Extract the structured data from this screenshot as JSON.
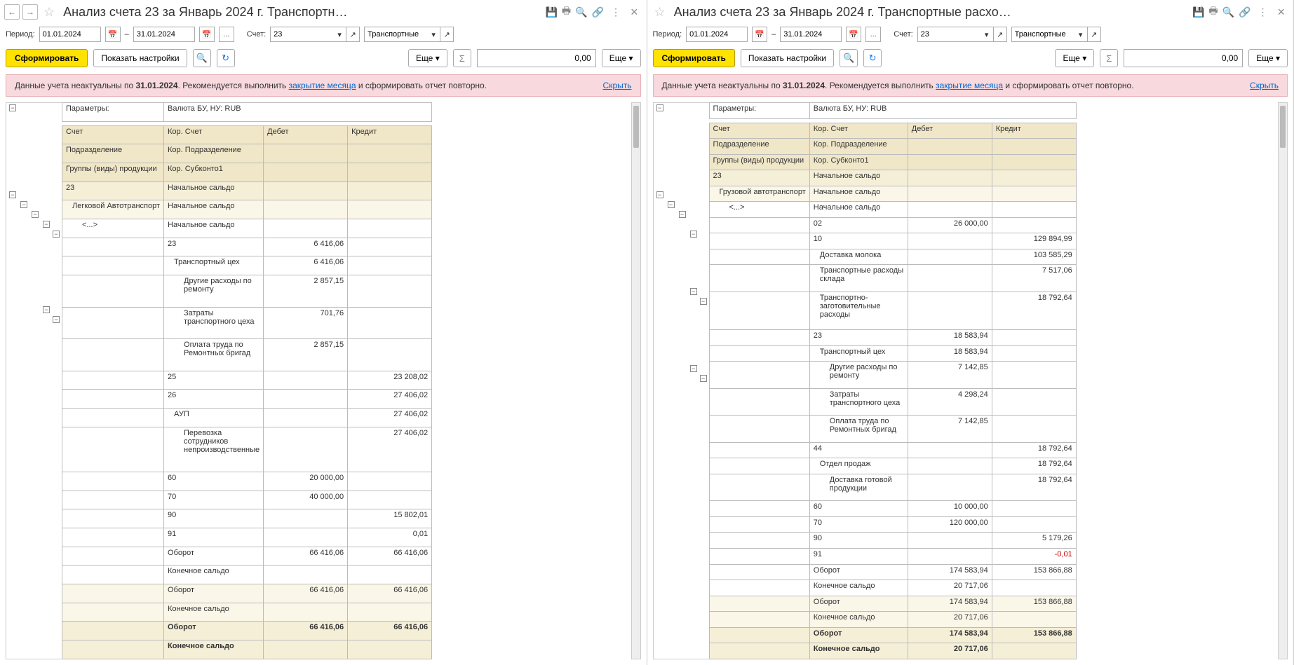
{
  "titleLeft": "Анализ счета 23 за Январь 2024 г. Транспортн…",
  "titleRight": "Анализ счета 23 за Январь 2024 г. Транспортные расхо…",
  "periodLabel": "Период:",
  "dateFrom": "01.01.2024",
  "dateTo": "31.01.2024",
  "dash": "–",
  "dotsBtn": "...",
  "acctLabel": "Счет:",
  "acctValue": "23",
  "orgValue": "Транспортные",
  "btnGenerate": "Сформировать",
  "btnSettings": "Показать настройки",
  "btnMore": "Еще",
  "numZero": "0,00",
  "alertPrefix": "Данные учета неактуальны по ",
  "alertDate": "31.01.2024",
  "alertMiddle": ". Рекомендуется выполнить ",
  "alertLink": "закрытие месяца",
  "alertSuffix": " и сформировать отчет повторно.",
  "hideLink": "Скрыть",
  "paramsLabel": "Параметры:",
  "paramsValue": "Валюта БУ, НУ: RUB",
  "hdr": {
    "acct": "Счет",
    "kor": "Кор. Счет",
    "deb": "Дебет",
    "cred": "Кредит",
    "dept": "Подразделение",
    "kordept": "Кор. Подразделение",
    "groups": "Группы (виды) продукции",
    "korsub": "Кор. Субконто1"
  },
  "txt": {
    "startBal": "Начальное сальдо",
    "endBal": "Конечное сальдо",
    "turnover": "Оборот",
    "ellipsis": "<...>",
    "a23": "23",
    "legkovoy": "Легковой Автотранспорт",
    "transCeh": "Транспортный цех",
    "drugRemont": "Другие расходы по ремонту",
    "zatrCeh": "Затраты транспортного цеха",
    "oplataRem": "Оплата труда по Ремонтных бригад",
    "a25": "25",
    "a26": "26",
    "aup": "АУП",
    "perevozka": "Перевозка сотрудников непроизводственные",
    "a60": "60",
    "a70": "70",
    "a90": "90",
    "a91": "91",
    "gruzovoy": "Грузовой автотранспорт",
    "a02": "02",
    "a10": "10",
    "dostavkaMoloka": "Доставка молока",
    "transRashSklada": "Транспортные расходы  склада",
    "transZagot": "Транспортно-заготовительные расходы",
    "a44": "44",
    "otdelProdazh": "Отдел продаж",
    "dostavkaGotov": "Доставка готовой продукции"
  },
  "v": {
    "l_23deb": "6 416,06",
    "l_transCehDeb": "6 416,06",
    "l_drugRemDeb": "2 857,15",
    "l_zatrCehDeb": "701,76",
    "l_oplataRemDeb": "2 857,15",
    "l_25cred": "23 208,02",
    "l_26cred": "27 406,02",
    "l_aupCred": "27 406,02",
    "l_perevozkaCred": "27 406,02",
    "l_60deb": "20 000,00",
    "l_70deb": "40 000,00",
    "l_90cred": "15 802,01",
    "l_91cred": "0,01",
    "l_turnDeb1": "66 416,06",
    "l_turnCred1": "66 416,06",
    "l_turnDeb2": "66 416,06",
    "l_turnCred2": "66 416,06",
    "l_turnDeb3": "66 416,06",
    "l_turnCred3": "66 416,06",
    "r_02deb": "26 000,00",
    "r_10cred": "129 894,99",
    "r_dostMolokaCred": "103 585,29",
    "r_transSkladaCred": "7 517,06",
    "r_transZagotCred": "18 792,64",
    "r_23deb": "18 583,94",
    "r_transCehDeb": "18 583,94",
    "r_drugRemDeb": "7 142,85",
    "r_zatrCehDeb": "4 298,24",
    "r_oplataRemDeb": "7 142,85",
    "r_44cred": "18 792,64",
    "r_otdelCred": "18 792,64",
    "r_dostGotovCred": "18 792,64",
    "r_60deb": "10 000,00",
    "r_70deb": "120 000,00",
    "r_90cred": "5 179,26",
    "r_91cred": "-0,01",
    "r_turn1deb": "174 583,94",
    "r_turn1cred": "153 866,88",
    "r_end1deb": "20 717,06",
    "r_turn2deb": "174 583,94",
    "r_turn2cred": "153 866,88",
    "r_end2deb": "20 717,06",
    "r_turn3deb": "174 583,94",
    "r_turn3cred": "153 866,88",
    "r_end3deb": "20 717,06"
  }
}
